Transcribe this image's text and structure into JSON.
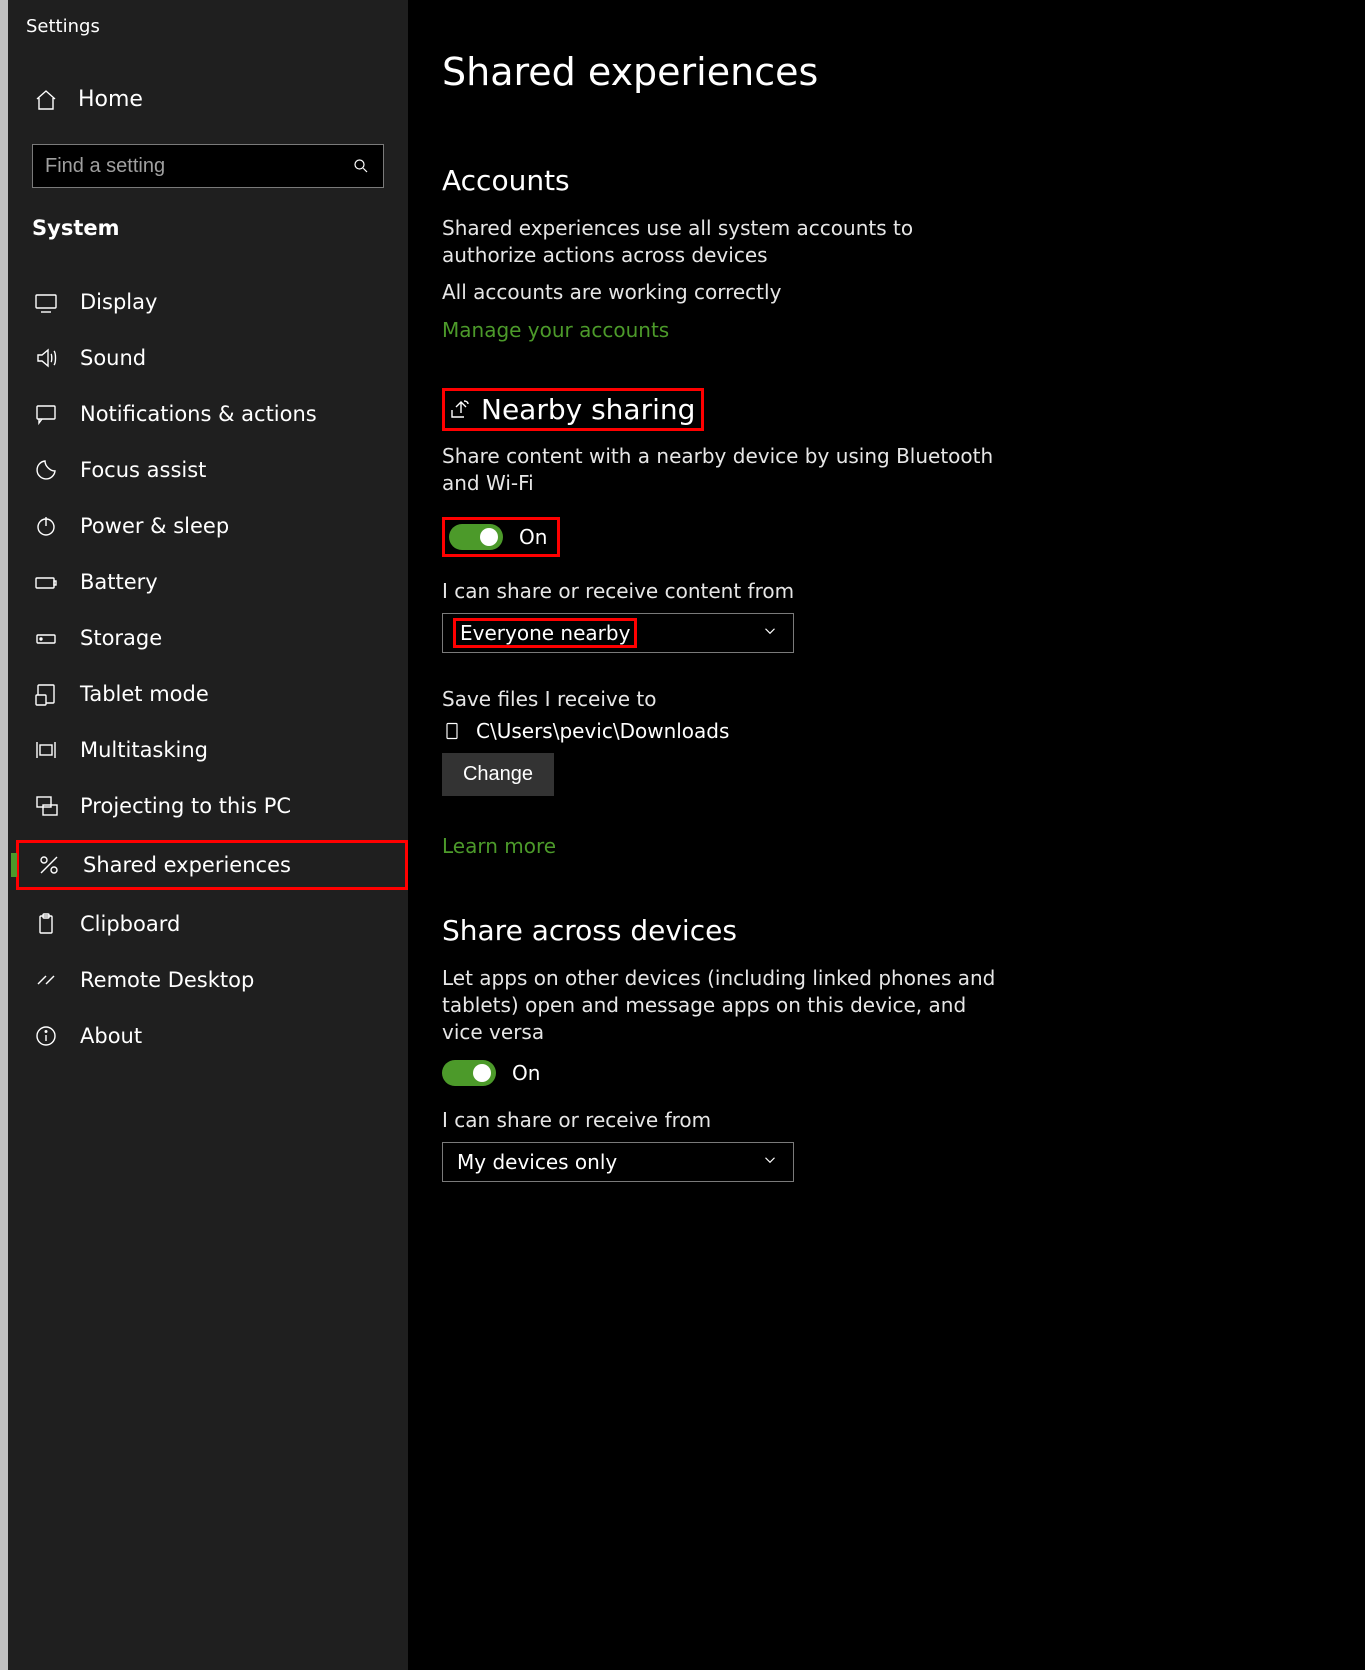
{
  "app_title": "Settings",
  "home_label": "Home",
  "search_placeholder": "Find a setting",
  "category": "System",
  "sidebar": {
    "items": [
      {
        "label": "Display"
      },
      {
        "label": "Sound"
      },
      {
        "label": "Notifications & actions"
      },
      {
        "label": "Focus assist"
      },
      {
        "label": "Power & sleep"
      },
      {
        "label": "Battery"
      },
      {
        "label": "Storage"
      },
      {
        "label": "Tablet mode"
      },
      {
        "label": "Multitasking"
      },
      {
        "label": "Projecting to this PC"
      },
      {
        "label": "Shared experiences"
      },
      {
        "label": "Clipboard"
      },
      {
        "label": "Remote Desktop"
      },
      {
        "label": "About"
      }
    ]
  },
  "page_title": "Shared experiences",
  "accounts": {
    "title": "Accounts",
    "desc": "Shared experiences use all system accounts to authorize actions across devices",
    "status": "All accounts are working correctly",
    "manage_link": "Manage your accounts"
  },
  "nearby": {
    "title": "Nearby sharing",
    "desc": "Share content with a nearby device by using Bluetooth and Wi-Fi",
    "toggle_label": "On",
    "scope_label": "I can share or receive content from",
    "scope_value": "Everyone nearby",
    "save_label": "Save files I receive to",
    "save_path": "C\\Users\\pevic\\Downloads",
    "change_label": "Change",
    "learn_more": "Learn more"
  },
  "across": {
    "title": "Share across devices",
    "desc": "Let apps on other devices (including linked phones and tablets) open and message apps on this device, and vice versa",
    "toggle_label": "On",
    "scope_label": "I can share or receive from",
    "scope_value": "My devices only"
  }
}
